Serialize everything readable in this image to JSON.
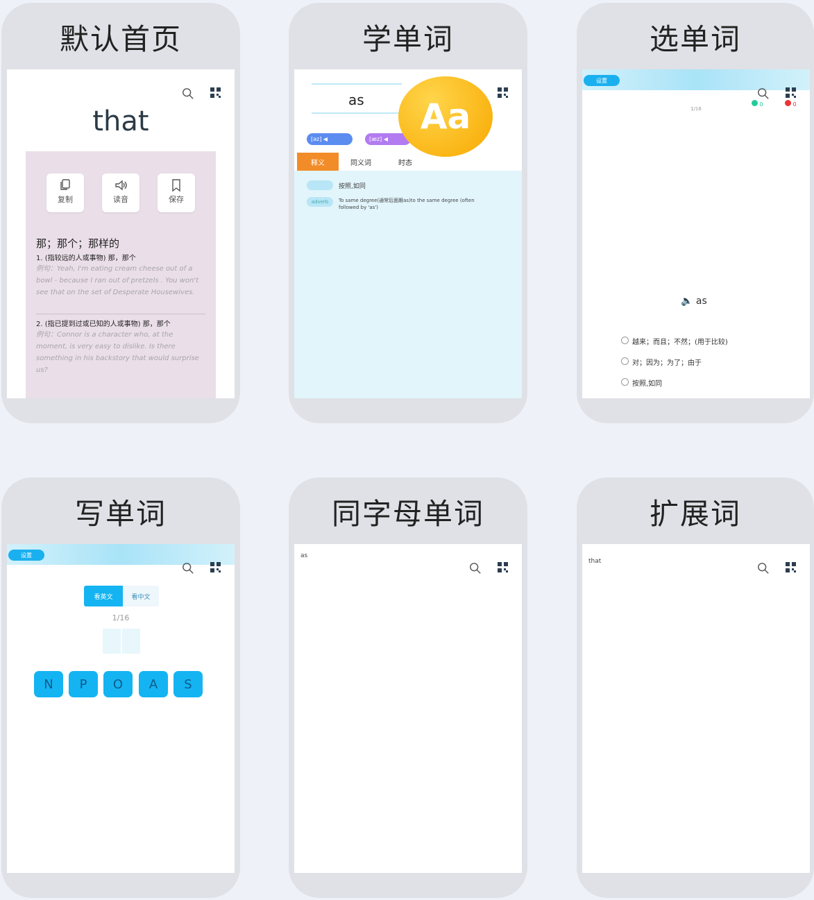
{
  "phones": {
    "home": {
      "title": "默认首页",
      "word": "that",
      "buttons": [
        {
          "label": "复制",
          "icon": "copy-icon"
        },
        {
          "label": "读音",
          "icon": "speaker-icon"
        },
        {
          "label": "保存",
          "icon": "bookmark-icon"
        }
      ],
      "definition": "那；那个；那样的",
      "senses": [
        {
          "gloss": "1. (指较远的人或事物) 那，那个",
          "example": "例句：Yeah, I'm eating cream cheese out of a bowl - because I ran out of pretzels . You won't see that on the set of Desperate Housewives."
        },
        {
          "gloss": "2. (指已提到过或已知的人或事物) 那，那个",
          "example": "例句：Connor is a character who, at the moment, is very easy to dislike. Is there something in his backstory that would surprise us?"
        }
      ]
    },
    "learn": {
      "title": "学单词",
      "word": "as",
      "badge": "Aa",
      "phonetic1": "[əz]",
      "phonetic2": "[æz]",
      "tabs": [
        "释义",
        "同义词",
        "时态"
      ],
      "rows": [
        {
          "tag": "",
          "text": "按照,如同"
        },
        {
          "tag": "adverb",
          "text": "To same degree(通常后面跟as)to the same degree (often followed by 'as')"
        }
      ]
    },
    "choose": {
      "title": "选单词",
      "band_label": "设置",
      "progress": "1/16",
      "correct_count": "0",
      "wrong_count": "0",
      "word": "as",
      "options": [
        "越来；而且；不然；(用于比较)",
        "对；因为；为了；由于",
        "按照,如同"
      ]
    },
    "write": {
      "title": "写单词",
      "band_label": "设置",
      "seg_left": "看英文",
      "seg_right": "看中文",
      "progress": "1/16",
      "letters": [
        "N",
        "P",
        "O",
        "A",
        "S"
      ]
    },
    "same_letters": {
      "title": "同字母单词",
      "word": "as"
    },
    "extend": {
      "title": "扩展词",
      "word": "that"
    }
  },
  "colors": {
    "accent_blue": "#14b4f2",
    "accent_orange": "#f28c28",
    "aa_gold": "#f8a800",
    "def_card": "#eadfe8",
    "panel_blue": "#e1f5fb"
  }
}
